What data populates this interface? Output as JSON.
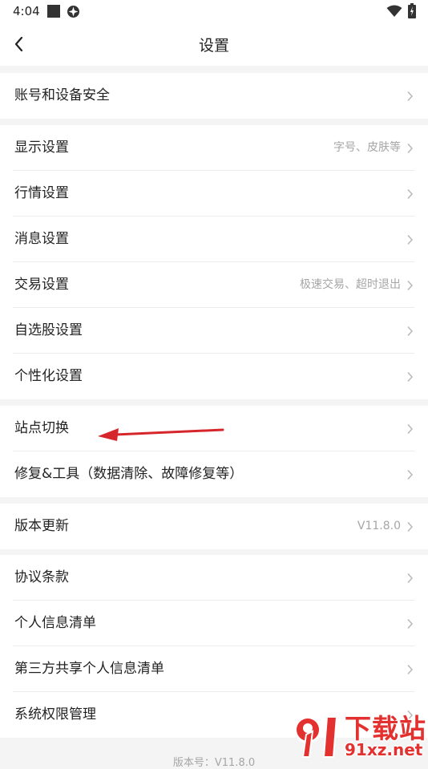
{
  "status_bar": {
    "time": "4:04",
    "icons": [
      "square-icon",
      "app-icon",
      "wifi-icon",
      "battery-icon"
    ]
  },
  "header": {
    "title": "设置",
    "back_icon": "back-arrow-icon"
  },
  "groups": [
    {
      "items": [
        {
          "label": "账号和设备安全",
          "value": ""
        }
      ]
    },
    {
      "items": [
        {
          "label": "显示设置",
          "value": "字号、皮肤等"
        },
        {
          "label": "行情设置",
          "value": ""
        },
        {
          "label": "消息设置",
          "value": ""
        },
        {
          "label": "交易设置",
          "value": "极速交易、超时退出"
        },
        {
          "label": "自选股设置",
          "value": ""
        },
        {
          "label": "个性化设置",
          "value": ""
        }
      ]
    },
    {
      "items": [
        {
          "label": "站点切换",
          "value": ""
        },
        {
          "label": "修复&工具（数据清除、故障修复等）",
          "value": ""
        }
      ]
    },
    {
      "items": [
        {
          "label": "版本更新",
          "value": "V11.8.0"
        }
      ]
    },
    {
      "items": [
        {
          "label": "协议条款",
          "value": ""
        },
        {
          "label": "个人信息清单",
          "value": ""
        },
        {
          "label": "第三方共享个人信息清单",
          "value": ""
        },
        {
          "label": "系统权限管理",
          "value": ""
        }
      ]
    }
  ],
  "footer": {
    "version_text": "版本号：V11.8.0"
  },
  "watermark": {
    "title": "下载站",
    "domain": "91xz.net"
  },
  "colors": {
    "background": "#f4f4f4",
    "card": "#ffffff",
    "text": "#222222",
    "secondary_text": "#a6a6a6",
    "annotation_arrow": "#d7262b"
  }
}
